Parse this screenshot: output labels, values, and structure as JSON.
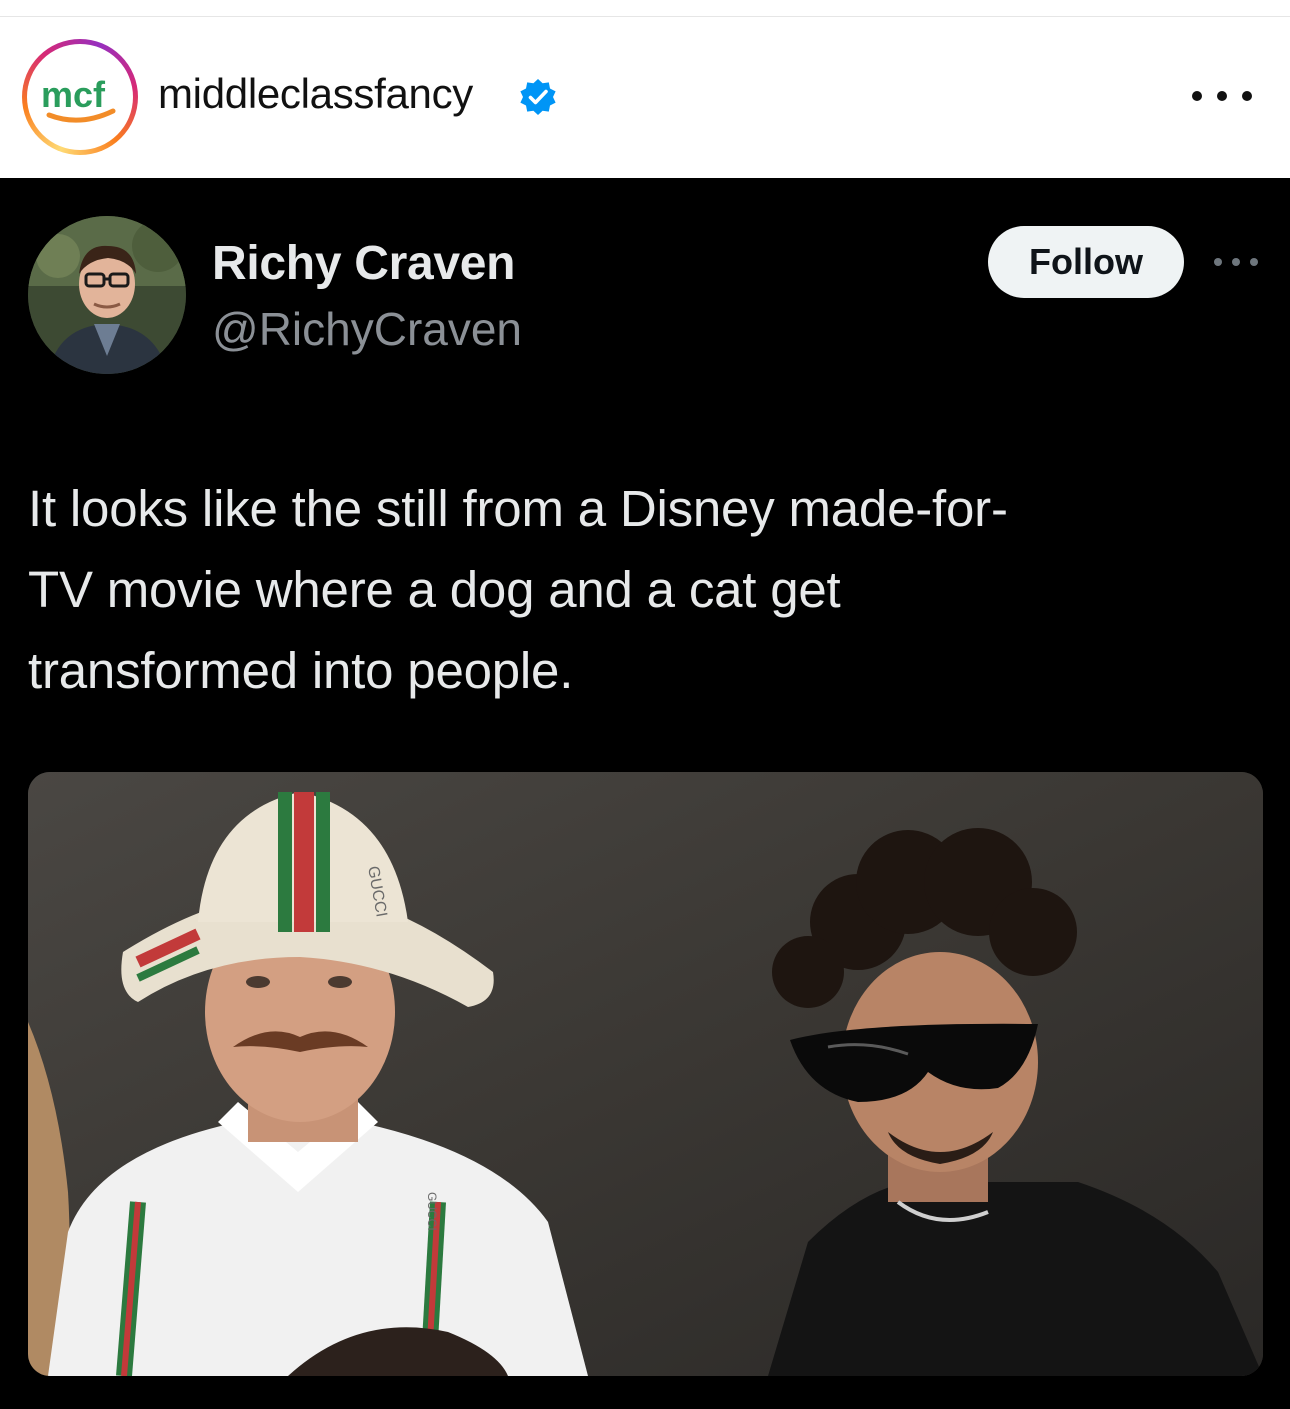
{
  "post": {
    "username": "middleclassfancy",
    "avatar_logo_text": "mcf",
    "verified": true,
    "more_icon": "more-horizontal-icon"
  },
  "tweet": {
    "display_name": "Richy Craven",
    "handle": "@RichyCraven",
    "follow_label": "Follow",
    "more_icon": "more-horizontal-icon",
    "lines": [
      "It looks like the still from a Disney made-for-",
      "TV movie where a dog and a cat get",
      "transformed into people."
    ],
    "media": {
      "hat_text": "GUCCI",
      "collar_text": "GUCCI"
    }
  },
  "colors": {
    "tweet_bg": "#000000",
    "verified_blue": "#0095f6",
    "mcf_green": "#2a9d5c",
    "mcf_orange": "#f28c28"
  }
}
